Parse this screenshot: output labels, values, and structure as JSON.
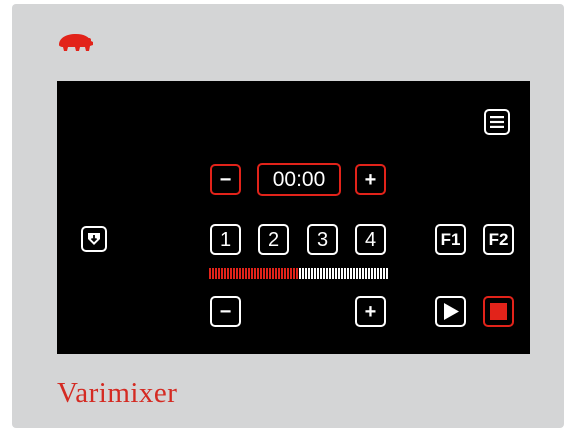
{
  "brand": {
    "name": "Varimixer",
    "color": "#d42a22"
  },
  "screen": {
    "menu_icon": "hamburger-menu-icon",
    "download_icon": "download-icon",
    "timer": {
      "minus_label": "−",
      "value": "00:00",
      "plus_label": "+"
    },
    "speeds": [
      "1",
      "2",
      "3",
      "4"
    ],
    "functions": [
      "F1",
      "F2"
    ],
    "speed_adjust": {
      "minus_label": "−",
      "plus_label": "+"
    },
    "level_meter": {
      "level_fraction": 0.5,
      "active_color": "#e2231a",
      "inactive_color": "#ffffff"
    },
    "play_icon": "play-icon",
    "stop_icon": "stop-icon"
  },
  "colors": {
    "accent": "#e2231a",
    "panel": "#d4d5d6",
    "screen": "#000000"
  }
}
